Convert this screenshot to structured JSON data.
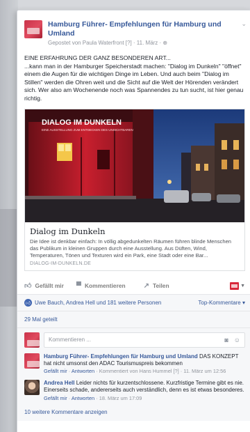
{
  "post": {
    "page_name": "Hamburg Führer- Empfehlungen für Hamburg und Umland",
    "posted_by": "Gepostet von Paula Waterfront",
    "meta_rest": " [?] · 11. März · ",
    "globe_icon": "globe-icon",
    "text_line1": "EINE ERFAHRUNG DER GANZ BESONDEREN ART...",
    "text_body": "...kann man in der Hamburger Speicherstadt machen: \"Dialog im Dunkeln\" \"öffnet\" einem die Augen für die wichtigen Dinge im Leben. Und auch beim \"Dialog im Stillen\" werden die Ohren weit und die Sicht auf die Welt der Hörenden verändert sich. Wer also am Wochenende noch was Spannendes zu tun sucht, ist hier genau richtig."
  },
  "link": {
    "title": "Dialog im Dunkeln",
    "description": "Die Idee ist denkbar einfach: In völlig abgedunkelten Räumen führen blinde Menschen das Publikum in kleinen Gruppen durch eine Ausstellung. Aus Düften, Wind, Temperaturen, Tönen und Texturen wird ein Park, eine Stadt oder eine Bar...",
    "domain": "DIALOG-IM-DUNKELN.DE",
    "image_sign": "DIALOG IM DUNKELN",
    "image_sign_sub": "EINE AUSSTELLUNG ZUM ENTDECKEN DES UNSICHTBAREN"
  },
  "actions": {
    "like": "Gefällt mir",
    "comment": "Kommentieren",
    "share": "Teilen"
  },
  "feedback": {
    "likes": "Uwe Bauch, Andrea Hell und 181 weitere Personen",
    "top_comments": "Top-Kommentare ▾",
    "shares": "29 Mal geteilt",
    "comment_placeholder": "Kommentieren ..."
  },
  "comments": [
    {
      "author": "Hamburg Führer- Empfehlungen für Hamburg und Umland",
      "text": " DAS KONZEPT hat nicht umsonst den ADAC Tourismuspreis bekommen",
      "like": "Gefällt mir",
      "reply": "Antworten",
      "meta": " · Kommentiert von Hans Hummel [?] · 11. März um 12:56"
    },
    {
      "author": "Andrea Hell",
      "text": " Leider nichts für kurzentschlossene. Kurzfristige Termine gibt es nie. Einerseits schade, andererseits auch verständlich, denn es ist etwas besonderes.",
      "like": "Gefällt mir",
      "reply": "Antworten",
      "meta": " · 18. März um 17:09"
    }
  ],
  "more_comments": "10 weitere Kommentare anzeigen",
  "colors": {
    "link_blue": "#365899",
    "brand_red": "#d8283a",
    "text": "#1d2129",
    "muted": "#90949c"
  }
}
